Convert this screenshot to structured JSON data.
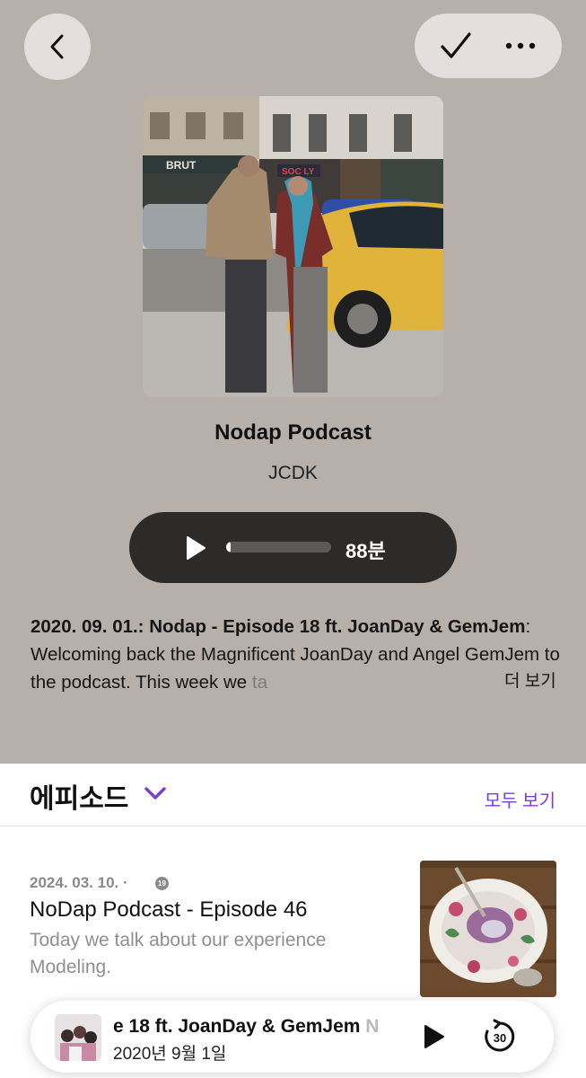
{
  "header": {
    "back_icon": "chevron-left-icon",
    "check_icon": "checkmark-icon",
    "more_icon": "ellipsis-icon"
  },
  "podcast": {
    "title": "Nodap Podcast",
    "author": "JCDK",
    "duration": "88분",
    "progress": 0.04,
    "cover_sign_1": "BRUT",
    "cover_sign_2": "SOC LY"
  },
  "description": {
    "bold_part": "2020. 09. 01.: Nodap - Episode 18 ft. JoanDay & GemJem",
    "text": ": Welcoming back the Magnificent JoanDay and Angel GemJem to the podcast. This week we ",
    "faded": "ta",
    "more": "더 보기"
  },
  "episodes_section": {
    "title": "에피소드",
    "see_all": "모두 보기"
  },
  "episode": {
    "date": "2024. 03. 10. ·",
    "age_rating": "19",
    "title": "NoDap Podcast - Episode 46",
    "description": "Today we talk about our experience Modeling."
  },
  "mini_player": {
    "title": "e 18 ft. JoanDay & GemJem",
    "title_trail": "N",
    "date": "2020년 9월 1일",
    "skip_label": "30"
  },
  "colors": {
    "hero_bg": "#b7afaa",
    "accent": "#7b3cd8",
    "pill_dark": "#2d2b2a"
  }
}
